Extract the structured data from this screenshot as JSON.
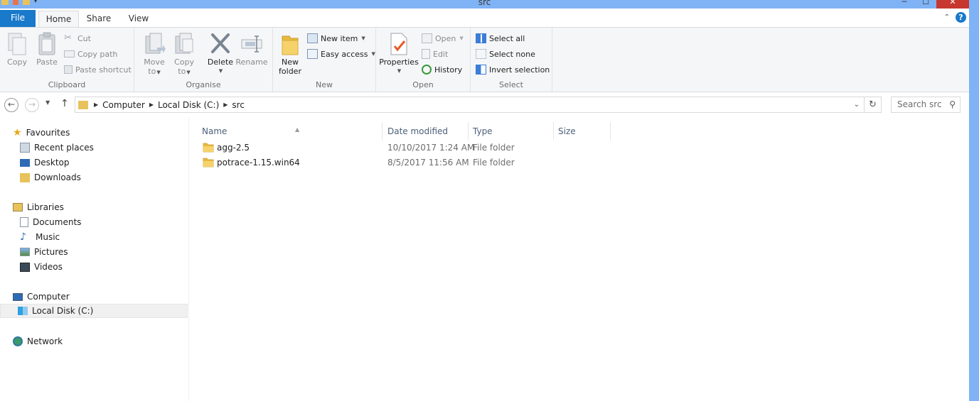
{
  "window": {
    "title": "src"
  },
  "colors": {
    "accent": "#1979ca",
    "titlebar": "#7fb3f5",
    "close": "#c7372f"
  },
  "ribbon_tabs": [
    {
      "label": "File"
    },
    {
      "label": "Home"
    },
    {
      "label": "Share"
    },
    {
      "label": "View"
    }
  ],
  "ribbon": {
    "clipboard": {
      "label": "Clipboard",
      "copy": "Copy",
      "paste": "Paste",
      "cut": "Cut",
      "copy_path": "Copy path",
      "paste_shortcut": "Paste shortcut"
    },
    "organise": {
      "label": "Organise",
      "move_to_1": "Move",
      "move_to_2": "to",
      "copy_to_1": "Copy",
      "copy_to_2": "to",
      "delete": "Delete",
      "rename": "Rename"
    },
    "new": {
      "label": "New",
      "new_folder_1": "New",
      "new_folder_2": "folder",
      "new_item": "New item",
      "easy_access": "Easy access"
    },
    "open": {
      "label": "Open",
      "properties": "Properties",
      "open": "Open",
      "edit": "Edit",
      "history": "History"
    },
    "select": {
      "label": "Select",
      "select_all": "Select all",
      "select_none": "Select none",
      "invert_selection": "Invert selection"
    }
  },
  "address": {
    "crumbs": [
      "Computer",
      "Local Disk (C:)",
      "src"
    ],
    "search_placeholder": "Search src"
  },
  "navpane": {
    "favourites": "Favourites",
    "recent_places": "Recent places",
    "desktop": "Desktop",
    "downloads": "Downloads",
    "libraries": "Libraries",
    "documents": "Documents",
    "music": "Music",
    "pictures": "Pictures",
    "videos": "Videos",
    "computer": "Computer",
    "local_disk": "Local Disk (C:)",
    "network": "Network"
  },
  "columns": {
    "name": "Name",
    "date_modified": "Date modified",
    "type": "Type",
    "size": "Size"
  },
  "files": [
    {
      "name": "agg-2.5",
      "date": "10/10/2017 1:24 AM",
      "type": "File folder"
    },
    {
      "name": "potrace-1.15.win64",
      "date": "8/5/2017 11:56 AM",
      "type": "File folder"
    }
  ]
}
